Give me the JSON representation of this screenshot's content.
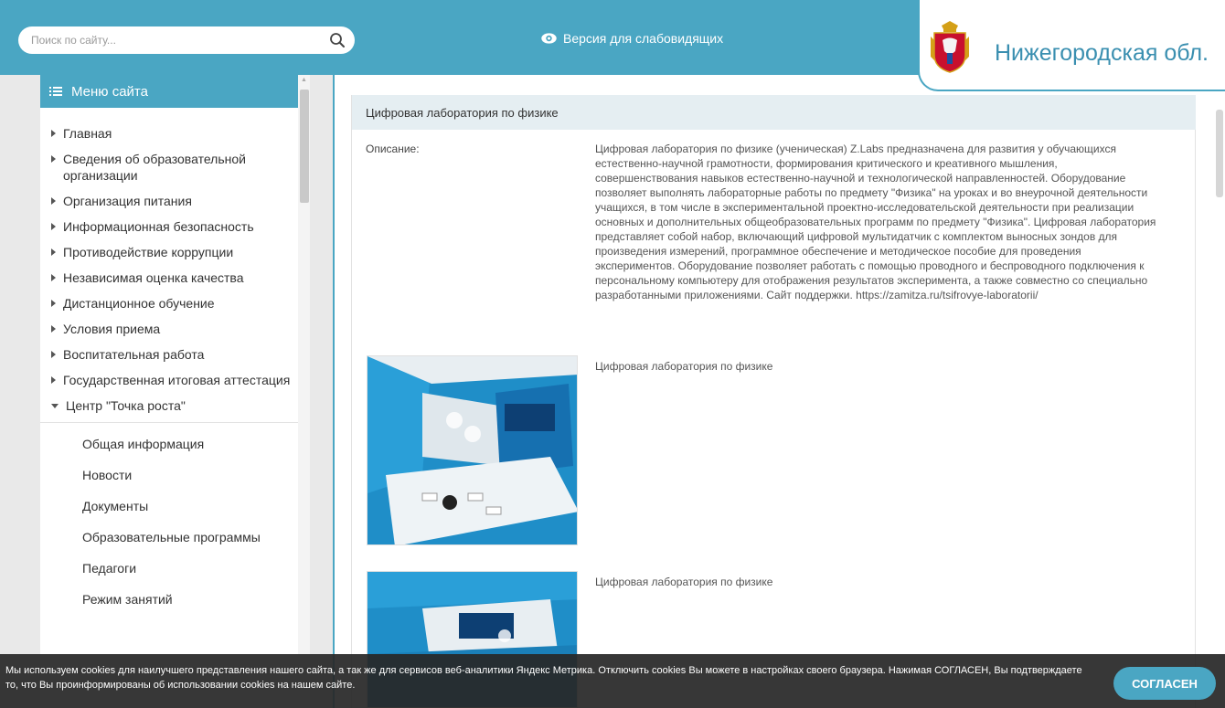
{
  "header": {
    "search_placeholder": "Поиск по сайту...",
    "visually_impaired": "Версия для слабовидящих",
    "region": "Нижегородская обл.",
    "brand_color": "#4aa6c3"
  },
  "sidebar": {
    "title": "Меню сайта",
    "items": [
      {
        "label": "Главная"
      },
      {
        "label": "Сведения об образовательной организации"
      },
      {
        "label": "Организация питания"
      },
      {
        "label": "Информационная безопасность"
      },
      {
        "label": "Противодействие коррупции"
      },
      {
        "label": "Независимая оценка качества"
      },
      {
        "label": "Дистанционное обучение"
      },
      {
        "label": "Условия приема"
      },
      {
        "label": "Воспитательная работа"
      },
      {
        "label": "Государственная итоговая аттестация"
      },
      {
        "label": "Центр \"Точка роста\""
      }
    ],
    "sub_items": [
      {
        "label": "Общая информация"
      },
      {
        "label": "Новости"
      },
      {
        "label": "Документы"
      },
      {
        "label": "Образовательные программы"
      },
      {
        "label": "Педагоги"
      },
      {
        "label": "Режим занятий"
      }
    ]
  },
  "main": {
    "title": "Цифровая лаборатория по физике",
    "description_label": "Описание:",
    "description": "Цифровая лаборатория по физике (ученическая) Z.Labs предназначена для развития у обучающихся естественно-научной грамотности, формирования критического и креативного мышления, совершенствования навыков естественно-научной и технологической направленностей. Оборудование позволяет выполнять лабораторные работы по предмету \"Физика\" на уроках и во внеурочной деятельности учащихся, в том числе в экспериментальной проектно-исследовательской деятельности при реализации основных и дополнительных общеобразовательных программ по предмету \"Физика\". Цифровая лаборатория представляет собой набор, включающий цифровой мультидатчик с комплектом выносных зондов для произведения измерений, программное обеспечение и методическое пособие для проведения экспериментов. Оборудование позволяет работать с помощью проводного и беспроводного подключения к персональному компьютеру для отображения результатов эксперимента, а также совместно со специально разработанными приложениями. Сайт поддержки. https://zamitza.ru/tsifrovye-laboratorii/",
    "photos": [
      {
        "caption": "Цифровая лаборатория по физике"
      },
      {
        "caption": "Цифровая лаборатория по физике"
      }
    ]
  },
  "cookie": {
    "text": "Мы используем cookies для наилучшего представления нашего сайта, а так же для сервисов веб-аналитики Яндекс Метрика. Отключить cookies Вы можете в настройках своего браузера. Нажимая СОГЛАСЕН, Вы подтверждаете то, что Вы проинформированы об использовании cookies на нашем сайте.",
    "button": "СОГЛАСЕН"
  }
}
